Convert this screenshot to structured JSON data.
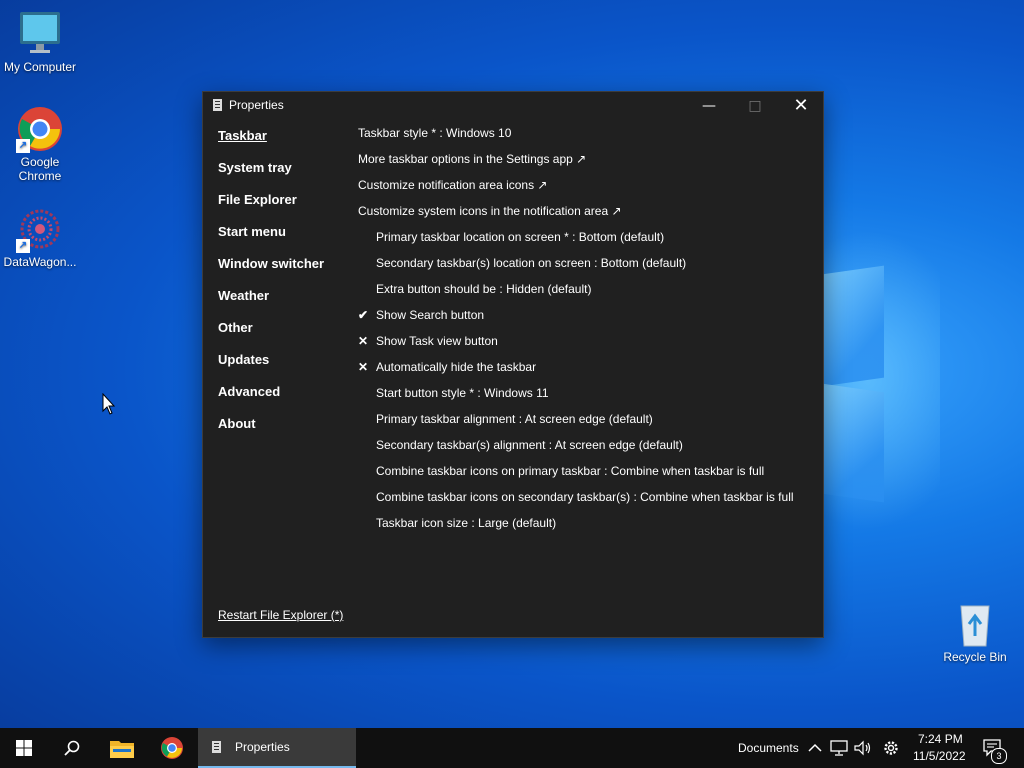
{
  "desktop": {
    "icons": [
      {
        "label": "My Computer"
      },
      {
        "label": "Google Chrome"
      },
      {
        "label": "DataWagon..."
      },
      {
        "label": "Recycle Bin"
      }
    ]
  },
  "window": {
    "title": "Properties",
    "nav": [
      "Taskbar",
      "System tray",
      "File Explorer",
      "Start menu",
      "Window switcher",
      "Weather",
      "Other",
      "Updates",
      "Advanced",
      "About"
    ],
    "active_nav": "Taskbar",
    "settings": [
      {
        "mark": "",
        "indent": false,
        "text": "Taskbar style * : Windows 10"
      },
      {
        "mark": "",
        "indent": false,
        "text": "More taskbar options in the Settings app ↗"
      },
      {
        "mark": "",
        "indent": false,
        "text": "Customize notification area icons ↗"
      },
      {
        "mark": "",
        "indent": false,
        "text": "Customize system icons in the notification area ↗"
      },
      {
        "mark": "",
        "indent": true,
        "text": "Primary taskbar location on screen * : Bottom (default)"
      },
      {
        "mark": "",
        "indent": true,
        "text": "Secondary taskbar(s) location on screen : Bottom (default)"
      },
      {
        "mark": "",
        "indent": true,
        "text": "Extra button should be : Hidden (default)"
      },
      {
        "mark": "✔",
        "indent": true,
        "text": "Show Search button"
      },
      {
        "mark": "✕",
        "indent": true,
        "text": "Show Task view button"
      },
      {
        "mark": "✕",
        "indent": true,
        "text": "Automatically hide the taskbar"
      },
      {
        "mark": "",
        "indent": true,
        "text": "Start button style * : Windows 11"
      },
      {
        "mark": "",
        "indent": true,
        "text": "Primary taskbar alignment : At screen edge (default)"
      },
      {
        "mark": "",
        "indent": true,
        "text": "Secondary taskbar(s) alignment : At screen edge (default)"
      },
      {
        "mark": "",
        "indent": true,
        "text": "Combine taskbar icons on primary taskbar : Combine when taskbar is full"
      },
      {
        "mark": "",
        "indent": true,
        "text": "Combine taskbar icons on secondary taskbar(s) : Combine when taskbar is full"
      },
      {
        "mark": "",
        "indent": true,
        "text": "Taskbar icon size : Large (default)"
      }
    ],
    "restart_link": "Restart File Explorer (*)"
  },
  "taskbar": {
    "active_app_label": "Properties",
    "toolbar_label": "Documents",
    "time": "7:24 PM",
    "date": "11/5/2022",
    "notification_count": "3"
  },
  "colors": {
    "window_bg": "#202020",
    "taskbar_bg": "#101010",
    "accent": "#76b9ed"
  }
}
